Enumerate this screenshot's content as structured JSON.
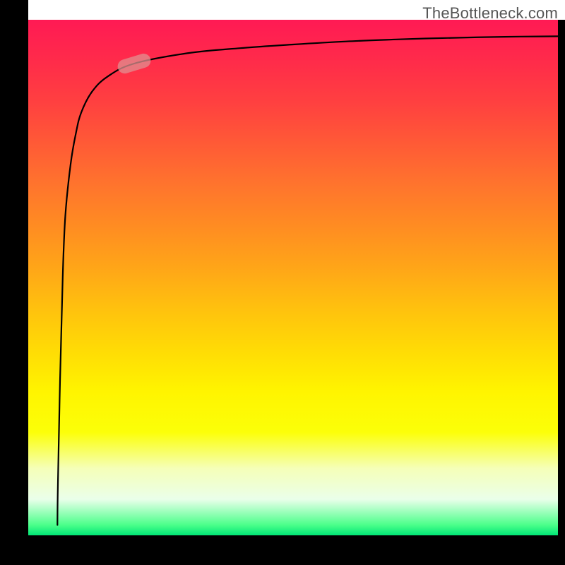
{
  "chart_data": {
    "type": "line",
    "title": "",
    "xlabel": "",
    "ylabel": "",
    "xlim": [
      0,
      100
    ],
    "ylim": [
      0,
      100
    ],
    "series": [
      {
        "name": "curve",
        "x": [
          5.5,
          5.6,
          6.0,
          6.5,
          7.0,
          8.0,
          9.0,
          10.0,
          12.0,
          15.0,
          20.0,
          30.0,
          40.0,
          50.0,
          60.0,
          70.0,
          80.0,
          90.0,
          100.0
        ],
        "y": [
          2.0,
          10.0,
          30.0,
          50.0,
          62.0,
          72.0,
          78.0,
          82.0,
          86.0,
          89.0,
          91.5,
          93.5,
          94.5,
          95.2,
          95.8,
          96.2,
          96.5,
          96.7,
          96.8
        ]
      }
    ],
    "marker_point": {
      "x": 20.0,
      "y": 91.5
    },
    "gradient_stops": [
      {
        "pos": 0.0,
        "color": "#ff1a54"
      },
      {
        "pos": 0.5,
        "color": "#ffc10e"
      },
      {
        "pos": 0.8,
        "color": "#fcff08"
      },
      {
        "pos": 1.0,
        "color": "#00e676"
      }
    ]
  },
  "watermark": "TheBottleneck.com"
}
